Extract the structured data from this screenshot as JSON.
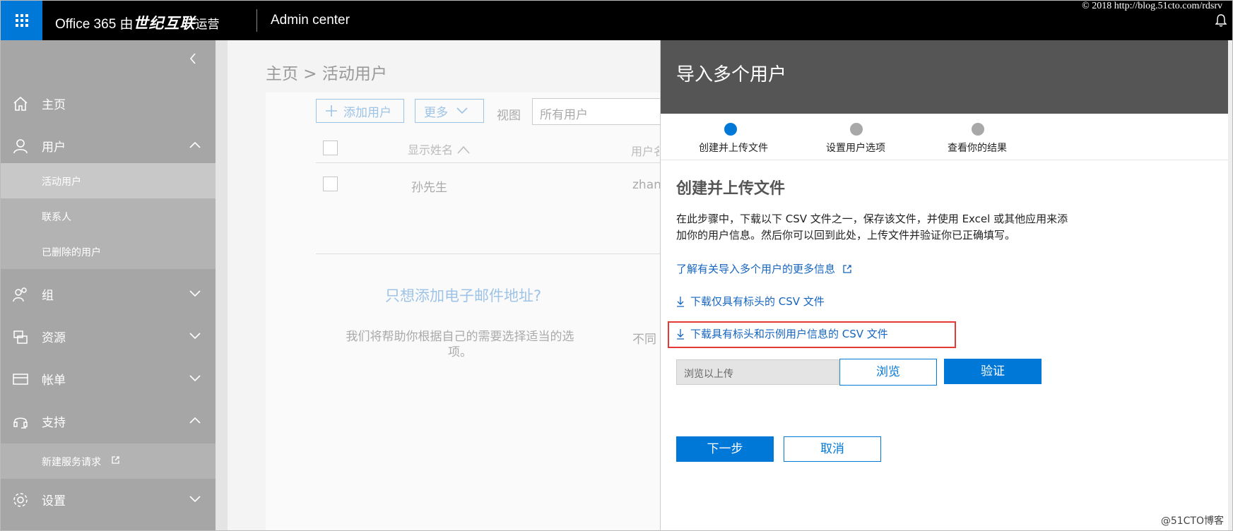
{
  "topbar": {
    "brand_prefix": "Office 365 由",
    "brand_cn": "世纪互联",
    "brand_suffix": "运营",
    "admin_center": "Admin center",
    "copyright": "© 2018 http://blog.51cto.com/rdsrv"
  },
  "sidebar": {
    "items": [
      {
        "label": "主页",
        "icon": "home-icon"
      },
      {
        "label": "用户",
        "icon": "user-icon"
      },
      {
        "label": "组",
        "icon": "group-icon"
      },
      {
        "label": "资源",
        "icon": "resources-icon"
      },
      {
        "label": "帐单",
        "icon": "billing-icon"
      },
      {
        "label": "支持",
        "icon": "support-icon"
      },
      {
        "label": "设置",
        "icon": "settings-icon"
      }
    ],
    "users_sub": [
      "活动用户",
      "联系人",
      "已删除的用户"
    ],
    "support_sub": [
      "新建服务请求"
    ]
  },
  "main": {
    "breadcrumb": "主页 > 活动用户",
    "add_user": "添加用户",
    "more": "更多",
    "view_label": "视图",
    "view_value": "所有用户",
    "col_display_name": "显示姓名",
    "col_username": "用户名",
    "row_name": "孙先生",
    "row_user": "zhan",
    "promo_title": "只想添加电子邮件地址?",
    "promo_text": "我们将帮助你根据自己的需要选择适当的选项。",
    "promo_text2": "不同"
  },
  "panel": {
    "title": "导入多个用户",
    "steps": [
      {
        "label": "创建并上传文件",
        "active": true
      },
      {
        "label": "设置用户选项",
        "active": false
      },
      {
        "label": "查看你的结果",
        "active": false
      }
    ],
    "section_title": "创建并上传文件",
    "description_line1": "在此步骤中，下载以下 CSV 文件之一，保存该文件，并使用 Excel 或其他应用来添",
    "description_line2": "加你的用户信息。然后你可以回到此处，上传文件并验证你已正确填写。",
    "learn_more": "了解有关导入多个用户的更多信息",
    "download_headers": "下载仅具有标头的 CSV 文件",
    "download_sample": "下载具有标头和示例用户信息的 CSV 文件",
    "upload_placeholder": "浏览以上传",
    "browse": "浏览",
    "verify": "验证",
    "next": "下一步",
    "cancel": "取消"
  },
  "watermark": "@51CTO博客",
  "colors": {
    "accent": "#0078d7",
    "sidebar": "#a6a6a6",
    "header": "#555555",
    "highlight": "#e53935"
  }
}
